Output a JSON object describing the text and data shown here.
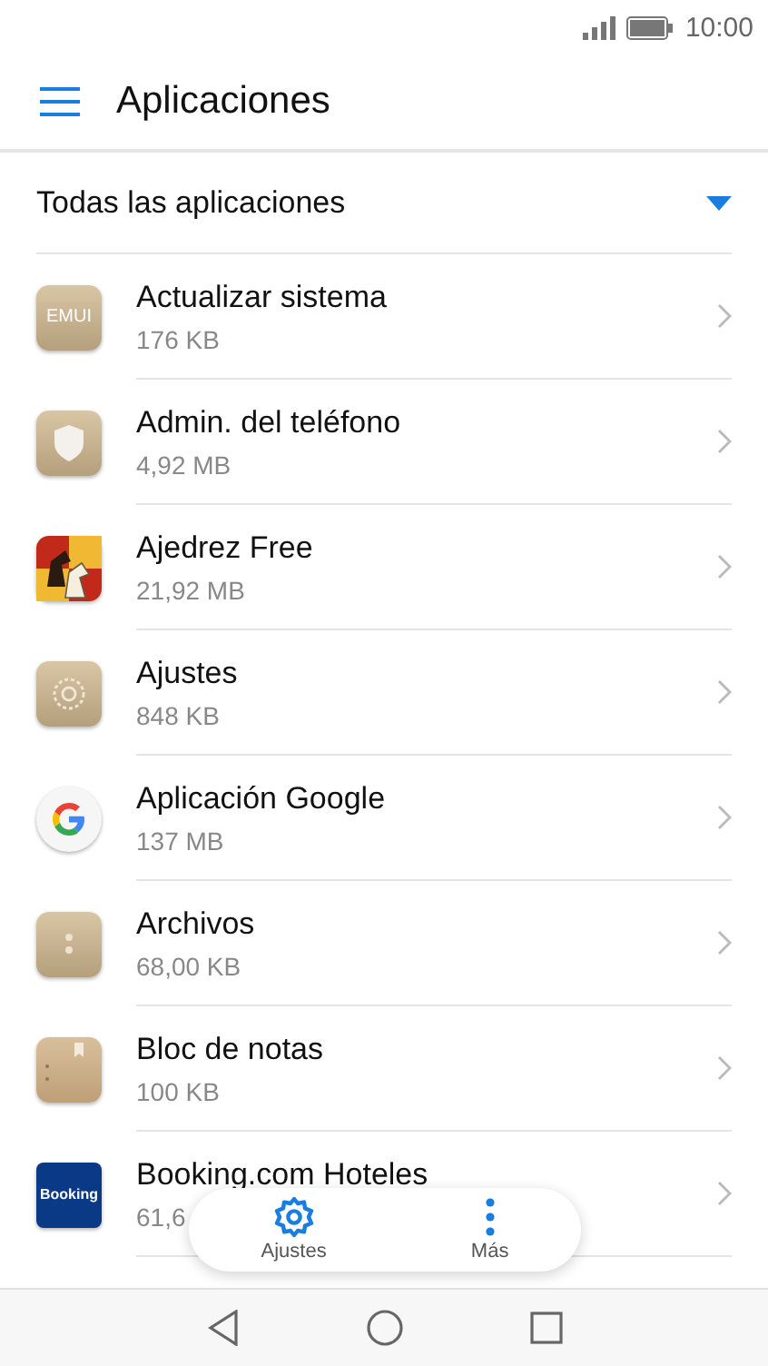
{
  "status_bar": {
    "time": "10:00"
  },
  "toolbar": {
    "title": "Aplicaciones"
  },
  "filter": {
    "label": "Todas las aplicaciones"
  },
  "apps": [
    {
      "name": "Actualizar sistema",
      "size": "176 KB",
      "kind": "emui",
      "icon_text": "EMUI"
    },
    {
      "name": "Admin. del teléfono",
      "size": "4,92 MB",
      "kind": "shield"
    },
    {
      "name": "Ajedrez Free",
      "size": "21,92 MB",
      "kind": "chess"
    },
    {
      "name": "Ajustes",
      "size": "848 KB",
      "kind": "gear"
    },
    {
      "name": "Aplicación Google",
      "size": "137 MB",
      "kind": "google"
    },
    {
      "name": "Archivos",
      "size": "68,00 KB",
      "kind": "box"
    },
    {
      "name": "Bloc de notas",
      "size": "100 KB",
      "kind": "notebook"
    },
    {
      "name": "Booking.com Hoteles",
      "size": "61,6",
      "kind": "booking",
      "icon_text": "Booking"
    }
  ],
  "floating_bar": [
    {
      "label": "Ajustes",
      "kind": "settings"
    },
    {
      "label": "Más",
      "kind": "more"
    }
  ]
}
